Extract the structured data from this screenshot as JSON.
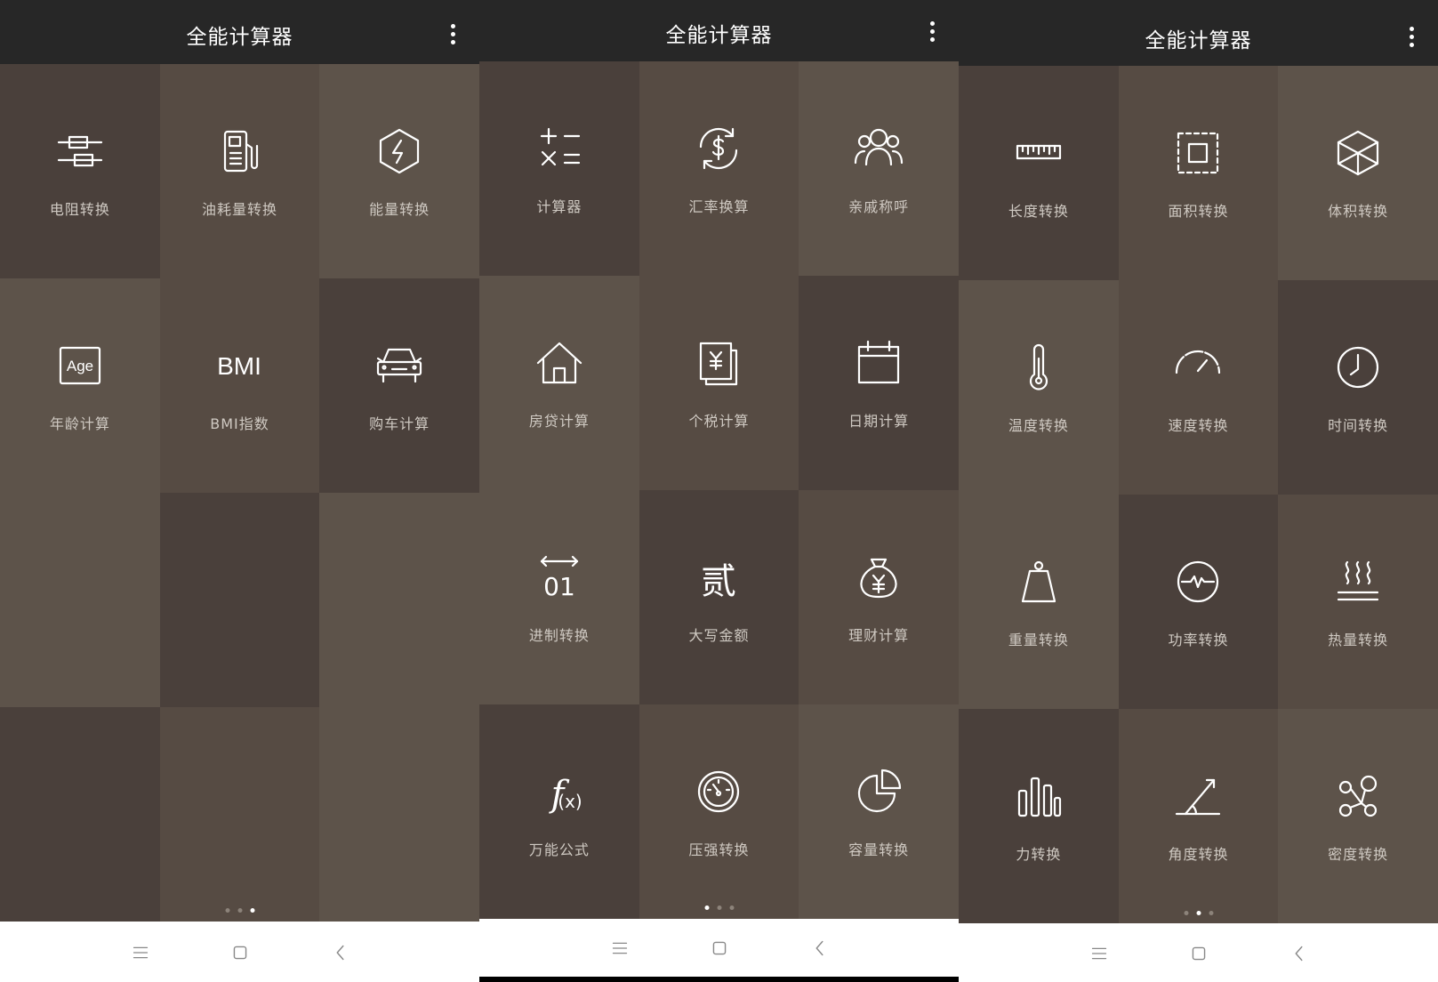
{
  "colors": {
    "appbar": "#272727",
    "tile_dark": "#4a403b",
    "tile_mid": "#564b43",
    "tile_light": "#5d534a",
    "label": "#cfc9c2",
    "navbar": "#ffffff"
  },
  "panels": [
    {
      "title": "全能计算器",
      "page_indicator": {
        "count": 3,
        "active": 2
      },
      "tiles": [
        {
          "label": "电阻转换",
          "icon": "resistor-icon",
          "tone": "dark"
        },
        {
          "label": "油耗量转换",
          "icon": "fuel-pump-icon",
          "tone": "mid"
        },
        {
          "label": "能量转换",
          "icon": "energy-hexagon-icon",
          "tone": "light"
        },
        {
          "label": "年龄计算",
          "icon": "age-icon",
          "tone": "light"
        },
        {
          "label": "BMI指数",
          "icon": "bmi-icon",
          "icon_text": "BMI",
          "tone": "mid"
        },
        {
          "label": "购车计算",
          "icon": "car-icon",
          "tone": "dark"
        },
        {
          "label": "",
          "icon": "",
          "tone": "light"
        },
        {
          "label": "",
          "icon": "",
          "tone": "dark"
        },
        {
          "label": "",
          "icon": "",
          "tone": "light"
        },
        {
          "label": "",
          "icon": "",
          "tone": "dark"
        },
        {
          "label": "",
          "icon": "",
          "tone": "mid"
        },
        {
          "label": "",
          "icon": "",
          "tone": "light"
        }
      ]
    },
    {
      "title": "全能计算器",
      "page_indicator": {
        "count": 3,
        "active": 0
      },
      "tiles": [
        {
          "label": "计算器",
          "icon": "calculator-operators-icon",
          "tone": "dark"
        },
        {
          "label": "汇率换算",
          "icon": "currency-exchange-icon",
          "tone": "mid"
        },
        {
          "label": "亲戚称呼",
          "icon": "relatives-icon",
          "tone": "light"
        },
        {
          "label": "房贷计算",
          "icon": "house-icon",
          "tone": "light"
        },
        {
          "label": "个税计算",
          "icon": "tax-document-icon",
          "tone": "mid"
        },
        {
          "label": "日期计算",
          "icon": "calendar-icon",
          "tone": "dark"
        },
        {
          "label": "进制转换",
          "icon": "number-base-icon",
          "icon_text": "01",
          "tone": "light"
        },
        {
          "label": "大写金额",
          "icon": "uppercase-amount-icon",
          "icon_text": "贰",
          "tone": "dark"
        },
        {
          "label": "理财计算",
          "icon": "money-bag-icon",
          "tone": "mid"
        },
        {
          "label": "万能公式",
          "icon": "formula-icon",
          "tone": "dark"
        },
        {
          "label": "压强转换",
          "icon": "pressure-gauge-icon",
          "tone": "mid"
        },
        {
          "label": "容量转换",
          "icon": "pie-chart-icon",
          "tone": "light"
        }
      ]
    },
    {
      "title": "全能计算器",
      "page_indicator": {
        "count": 3,
        "active": 1
      },
      "tiles": [
        {
          "label": "长度转换",
          "icon": "ruler-icon",
          "tone": "dark"
        },
        {
          "label": "面积转换",
          "icon": "area-icon",
          "tone": "mid"
        },
        {
          "label": "体积转换",
          "icon": "cube-icon",
          "tone": "light"
        },
        {
          "label": "温度转换",
          "icon": "thermometer-icon",
          "tone": "light"
        },
        {
          "label": "速度转换",
          "icon": "speedometer-icon",
          "tone": "mid"
        },
        {
          "label": "时间转换",
          "icon": "clock-icon",
          "tone": "dark"
        },
        {
          "label": "重量转换",
          "icon": "weight-icon",
          "tone": "light"
        },
        {
          "label": "功率转换",
          "icon": "power-pulse-icon",
          "tone": "dark"
        },
        {
          "label": "热量转换",
          "icon": "heat-icon",
          "tone": "mid"
        },
        {
          "label": "力转换",
          "icon": "force-bars-icon",
          "tone": "dark"
        },
        {
          "label": "角度转换",
          "icon": "angle-icon",
          "tone": "mid"
        },
        {
          "label": "密度转换",
          "icon": "density-molecule-icon",
          "tone": "light"
        }
      ]
    }
  ],
  "navbar": {
    "buttons": [
      {
        "icon": "menu-icon"
      },
      {
        "icon": "home-icon"
      },
      {
        "icon": "back-icon"
      }
    ]
  }
}
